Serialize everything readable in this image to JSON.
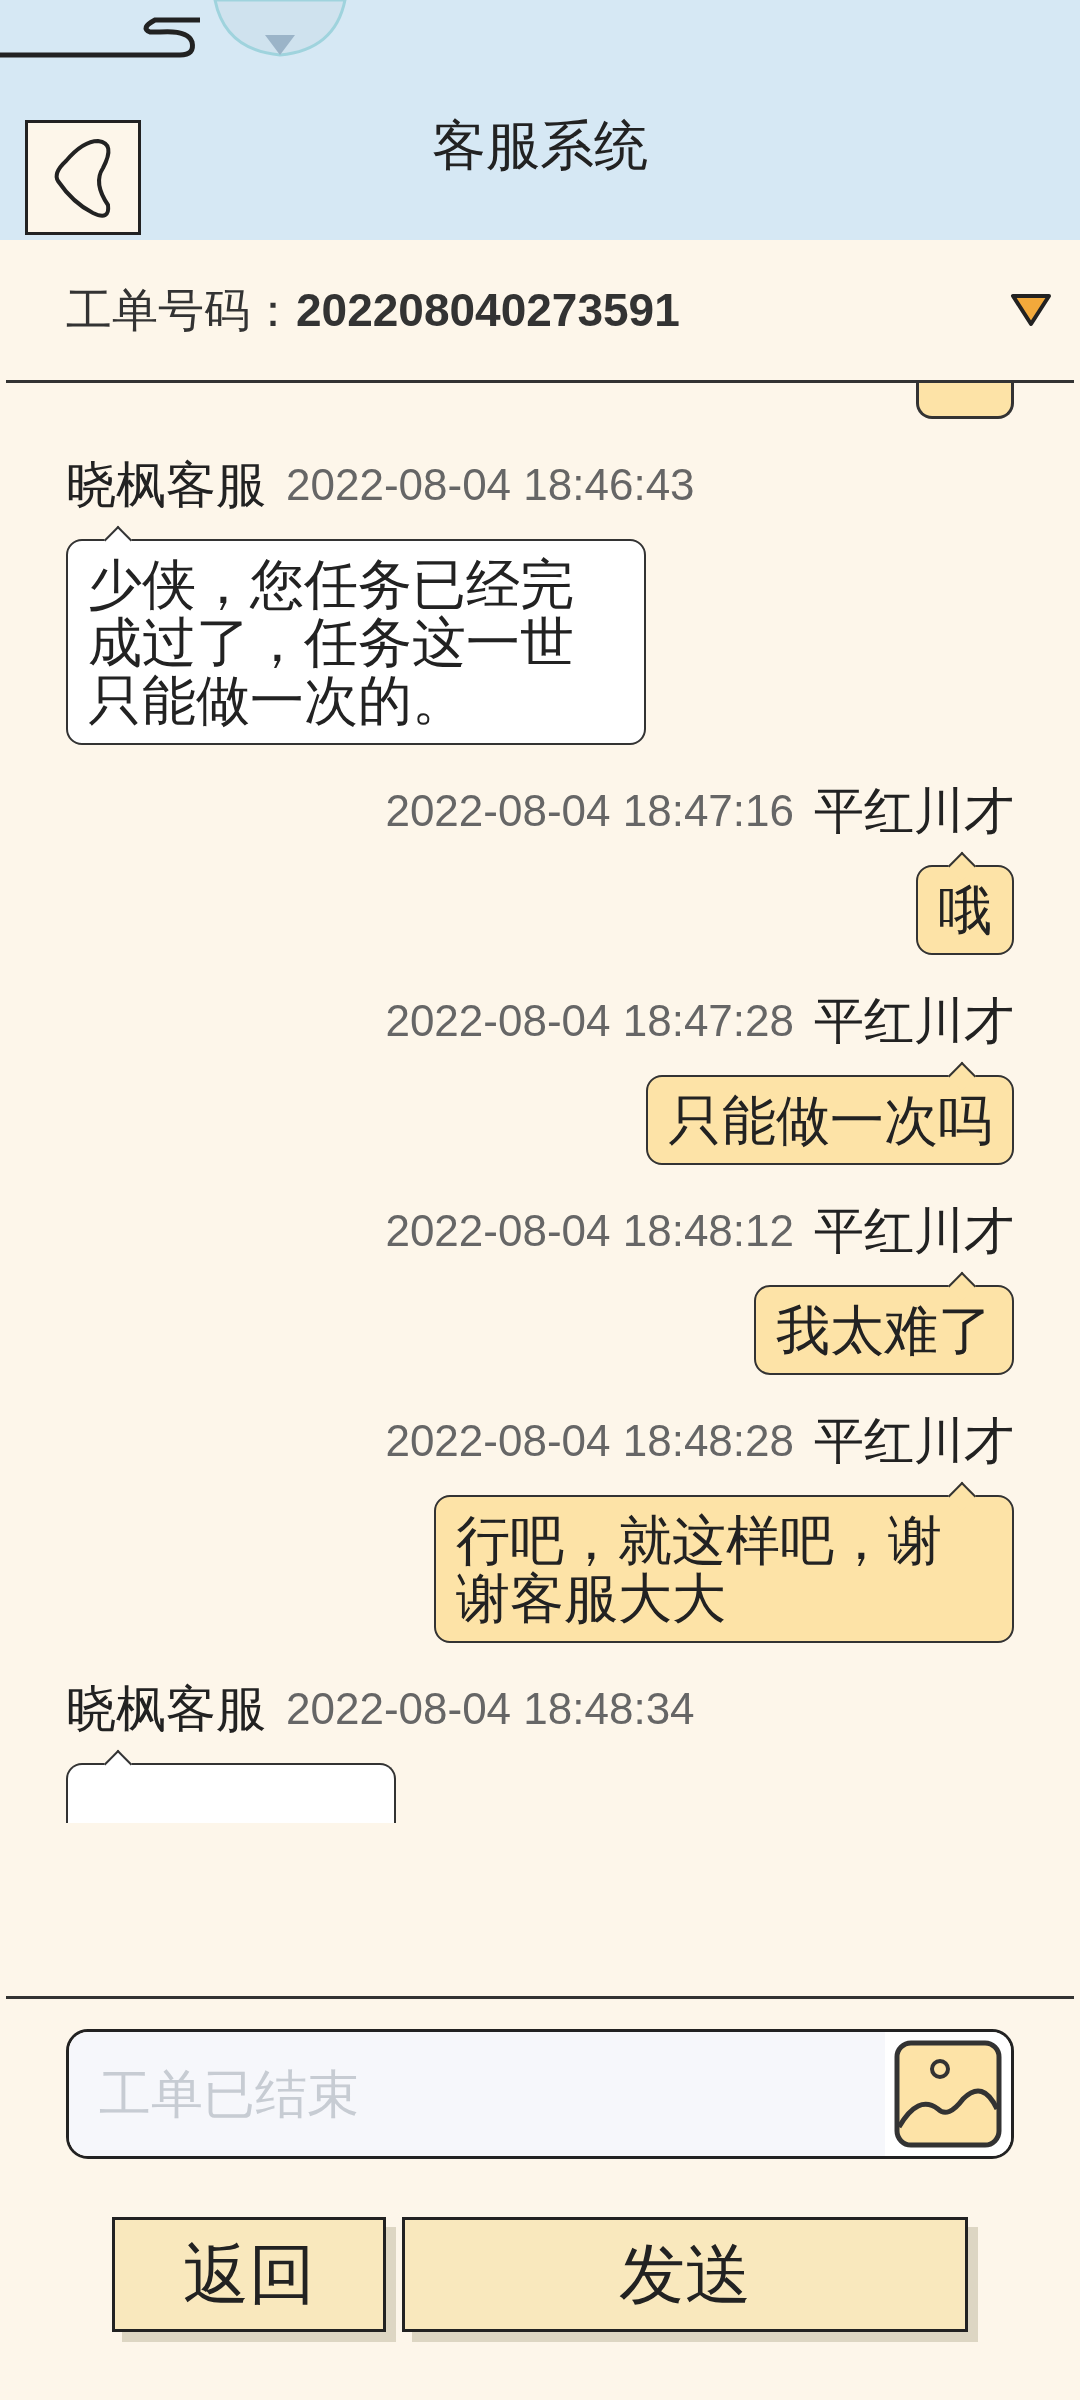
{
  "header": {
    "title": "客服系统"
  },
  "order": {
    "label": "工单号码：",
    "number": "202208040273591"
  },
  "messages": [
    {
      "kind": "user"
    },
    {
      "kind": "agent",
      "sender": "晓枫客服",
      "time": "2022-08-04 18:46:43",
      "text": "少侠，您任务已经完成过了，任务这一世只能做一次的。"
    },
    {
      "kind": "user",
      "sender": "平红川才",
      "time": "2022-08-04 18:47:16",
      "text": "哦"
    },
    {
      "kind": "user",
      "sender": "平红川才",
      "time": "2022-08-04 18:47:28",
      "text": "只能做一次吗"
    },
    {
      "kind": "user",
      "sender": "平红川才",
      "time": "2022-08-04 18:48:12",
      "text": "我太难了"
    },
    {
      "kind": "user",
      "sender": "平红川才",
      "time": "2022-08-04 18:48:28",
      "text": "行吧，就这样吧，谢谢客服大大"
    },
    {
      "kind": "agent",
      "sender": "晓枫客服",
      "time": "2022-08-04 18:48:34"
    }
  ],
  "input": {
    "placeholder": "工单已结束",
    "disabled": true
  },
  "buttons": [
    "返回",
    "发送"
  ]
}
